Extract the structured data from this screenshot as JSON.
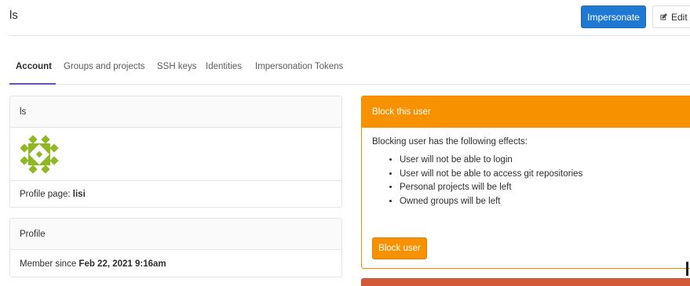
{
  "header": {
    "title": "ls",
    "impersonate_label": "Impersonate",
    "edit_label": "Edit"
  },
  "tabs": [
    {
      "label": "Account",
      "active": true
    },
    {
      "label": "Groups and projects",
      "active": false
    },
    {
      "label": "SSH keys",
      "active": false
    },
    {
      "label": "Identities",
      "active": false
    },
    {
      "label": "Impersonation Tokens",
      "active": false
    }
  ],
  "user_card": {
    "header": "ls",
    "profile_page_label": "Profile page:",
    "profile_page_value": "lisi"
  },
  "profile_card": {
    "header": "Profile",
    "member_since_label": "Member since",
    "member_since_value": "Feb 22, 2021 9:16am"
  },
  "block_card": {
    "header": "Block this user",
    "intro": "Blocking user has the following effects:",
    "effects": [
      "User will not be able to login",
      "User will not be able to access git repositories",
      "Personal projects will be left",
      "Owned groups will be left"
    ],
    "button_label": "Block user"
  },
  "colors": {
    "primary": "#1f78d1",
    "warning": "#f79100",
    "danger": "#d2593a",
    "active_tab": "#6b4fbb",
    "avatar": "#8fb825"
  },
  "icons": {
    "edit": "pencil-square-icon",
    "avatar": "identicon-avatar"
  }
}
